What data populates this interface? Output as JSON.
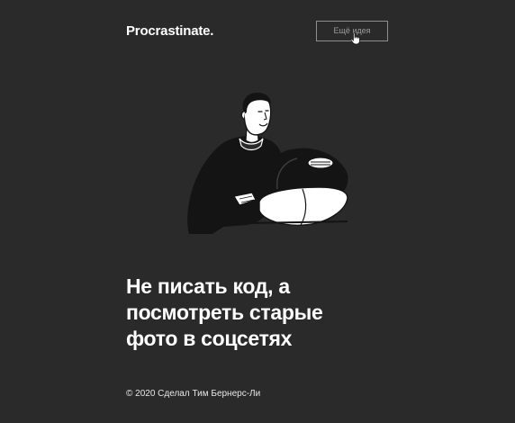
{
  "header": {
    "logo": "Procrastinate.",
    "idea_button_label": "Ещё идея"
  },
  "main": {
    "illustration_icon": "person-at-computer-illustration",
    "headline_lines": [
      "Не писать код, а",
      "посмотреть старые",
      "фото в соцсетях"
    ]
  },
  "footer": {
    "credit": "© 2020 Сделал Тим Бернерс-Ли"
  },
  "colors": {
    "background": "#2b2a2a",
    "text": "#ffffff",
    "button_border": "#8f8f8f",
    "button_text": "#9c9c9c"
  }
}
